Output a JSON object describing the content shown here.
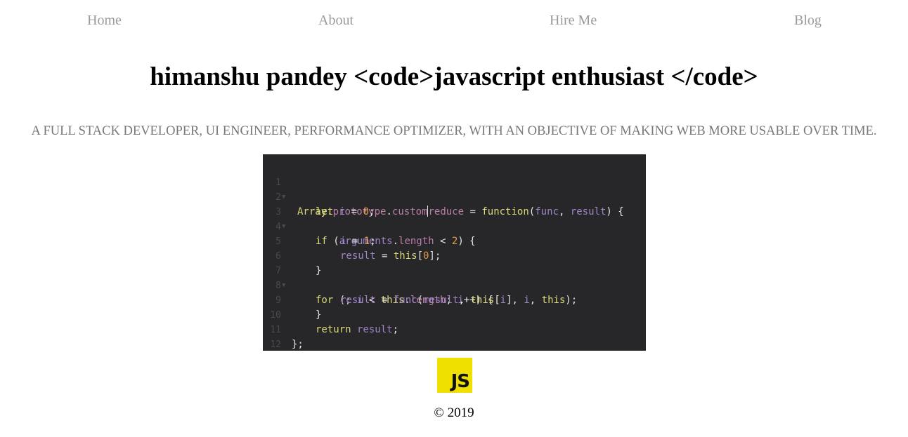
{
  "nav": {
    "items": [
      {
        "label": "Home"
      },
      {
        "label": "About"
      },
      {
        "label": "Hire Me"
      },
      {
        "label": "Blog"
      }
    ]
  },
  "header": {
    "title": "himanshu pandey <code>javascript enthusiast </code>",
    "subtitle": "A FULL STACK DEVELOPER, UI ENGINEER, PERFORMANCE OPTIMIZER, WITH AN OBJECTIVE OF MAKING WEB MORE USABLE OVER TIME."
  },
  "code_image": {
    "line_numbers": [
      "1",
      "2",
      "3",
      "4",
      "5",
      "6",
      "7",
      "8",
      "9",
      "10",
      "11",
      "12"
    ],
    "lines": [
      "Array.prototype.customreduce = function(func, result) {",
      "    let i = 0;",
      "    if (arguments.length < 2) {",
      "        i = 1;",
      "        result = this[0];",
      "    }",
      "    for (; i < this.length; i++) {",
      "        result = func(result, this[i], i, this);",
      "    }",
      "    return result;",
      "};",
      ""
    ],
    "colors": {
      "background": "#272629",
      "keyword": "#d9d97a",
      "variable": "#9e85c7",
      "property": "#b97fa8",
      "number": "#e39b4a"
    }
  },
  "logo": {
    "text": "JS",
    "icon": "javascript-logo-icon",
    "color": "#f0e000"
  },
  "footer": {
    "copyright": "© 2019"
  }
}
